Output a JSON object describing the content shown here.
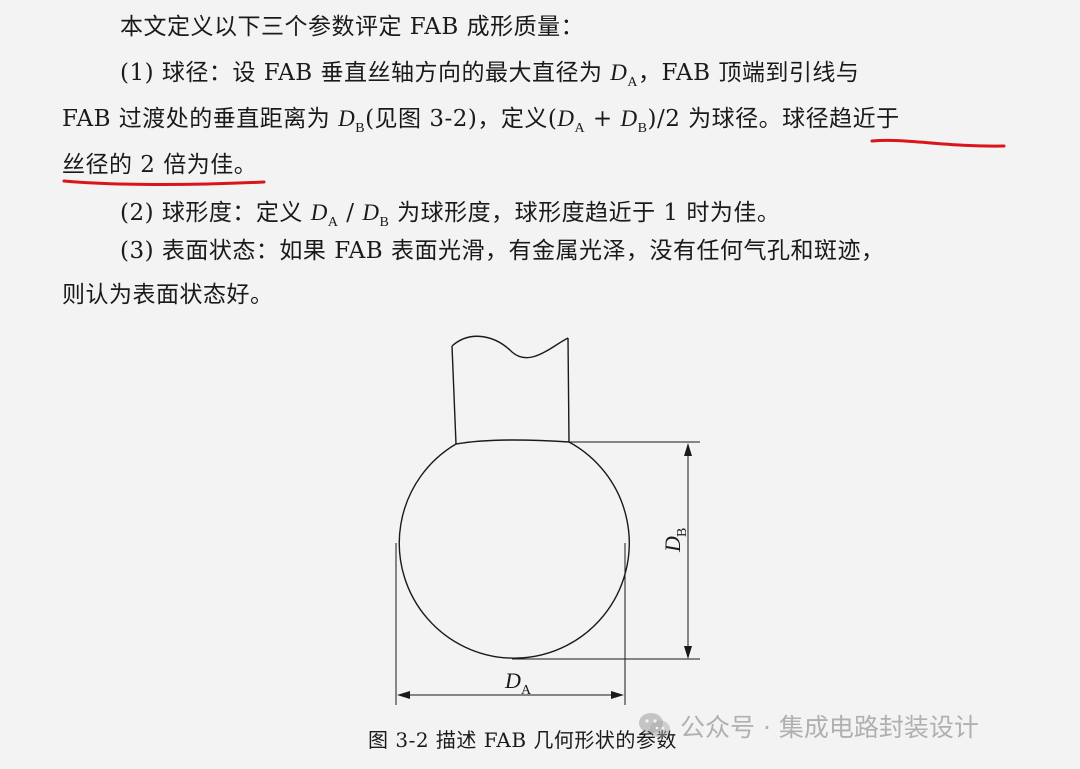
{
  "colors": {
    "text": "#1a1a1a",
    "background": "#f3f3f3",
    "underline": "#d9151b"
  },
  "paragraphs": {
    "intro": "本文定义以下三个参数评定 FAB 成形质量：",
    "p1_line1_a": "(1) 球径：设 FAB 垂直丝轴方向的最大直径为 ",
    "p1_line1_b": "，FAB 顶端到引线与",
    "p1_line2_a": "FAB 过渡处的垂直距离为 ",
    "p1_line2_b": "(见图 3-2)，定义(",
    "p1_line2_plus": " + ",
    "p1_line2_c": ")/2 为球径。",
    "p1_line2_highlight": "球径趋近于",
    "p1_line3_highlight": "丝径的 2 倍为佳。",
    "p2_a": "(2) 球形度：定义 ",
    "p2_slash": " / ",
    "p2_b": " 为球形度，球形度趋近于 1 时为佳。",
    "p3_line1": "(3) 表面状态：如果 FAB 表面光滑，有金属光泽，没有任何气孔和斑迹，",
    "p3_line2": "则认为表面状态好。"
  },
  "symbols": {
    "D": "D",
    "A": "A",
    "B": "B"
  },
  "figure": {
    "label_db_main": "D",
    "label_db_sub": "B",
    "label_da_main": "D",
    "label_da_sub": "A",
    "caption": "图 3-2  描述 FAB 几何形状的参数"
  },
  "watermark": {
    "icon": "wechat-icon",
    "text": "公众号 · 集成电路封装设计"
  }
}
